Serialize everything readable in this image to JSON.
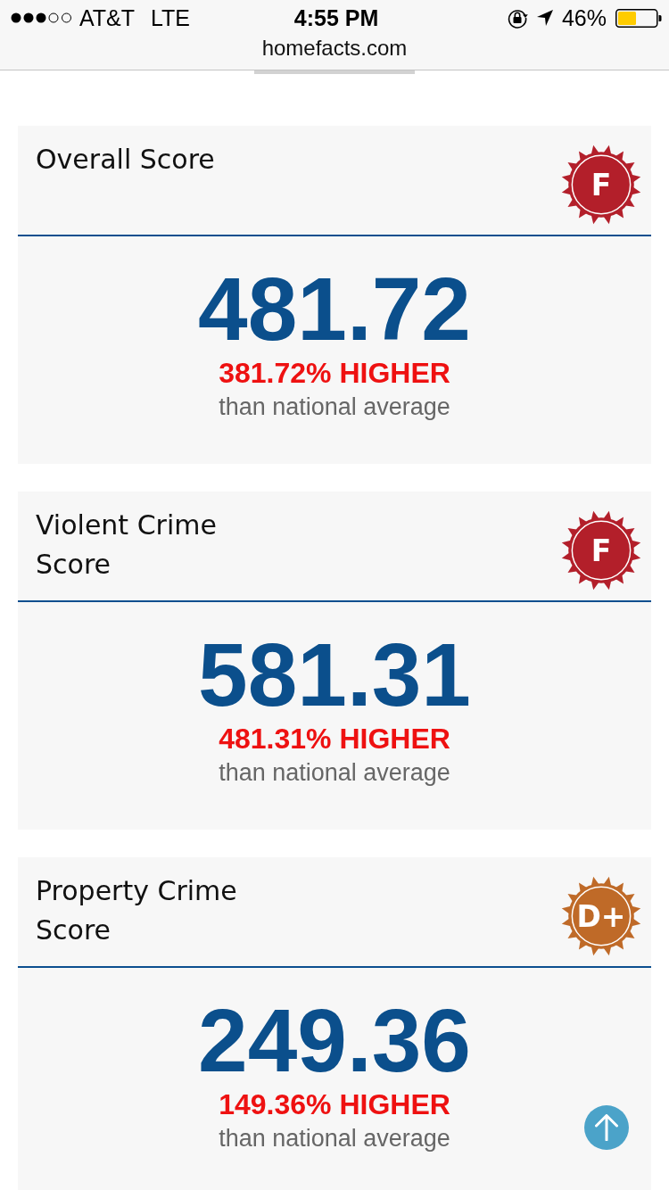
{
  "status_bar": {
    "carrier": "AT&T",
    "network": "LTE",
    "time": "4:55 PM",
    "battery": "46%"
  },
  "address_bar": {
    "url": "homefacts.com"
  },
  "score_cards": [
    {
      "title": "Overall Score",
      "grade": "F",
      "color": "#b31f2a",
      "score": "481.72",
      "comparison": "381.72% HIGHER",
      "note": "than national average"
    },
    {
      "title": "Violent Crime Score",
      "grade": "F",
      "color": "#b31f2a",
      "score": "581.31",
      "comparison": "481.31% HIGHER",
      "note": "than national average"
    },
    {
      "title": "Property Crime Score",
      "grade": "D+",
      "color": "#bf6a28",
      "score": "249.36",
      "comparison": "149.36% HIGHER",
      "note": "than national average"
    }
  ]
}
